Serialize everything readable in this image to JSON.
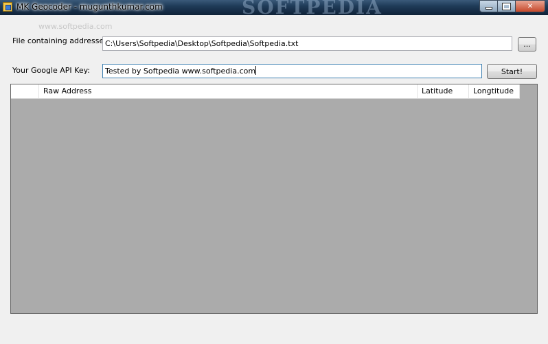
{
  "window": {
    "title": "MK Geocoder - mugunthkumar.com",
    "watermark": "SOFTPEDIA",
    "subwatermark": "www.softpedia.com"
  },
  "form": {
    "file_label": "File containing addresses:",
    "file_value": "C:\\Users\\Softpedia\\Desktop\\Softpedia\\Softpedia.txt",
    "browse_label": "...",
    "api_label": "Your Google API Key:",
    "api_value": "Tested by Softpedia www.softpedia.com",
    "start_label": "Start!"
  },
  "grid": {
    "columns": [
      "",
      "Raw Address",
      "Latitude",
      "Longtitude"
    ],
    "rows": []
  }
}
